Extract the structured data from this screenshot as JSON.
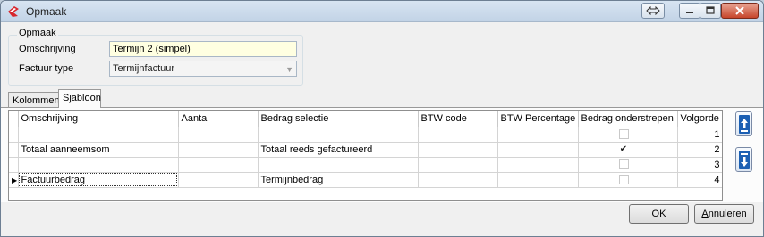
{
  "window": {
    "title": "Opmaak",
    "controls": [
      "restore-swap-icon",
      "minimize-icon",
      "maximize-icon",
      "close-icon"
    ]
  },
  "group": {
    "title": "Opmaak",
    "omschrijving_label": "Omschrijving",
    "omschrijving_value": "Termijn 2 (simpel)",
    "factuurtype_label": "Factuur type",
    "factuurtype_value": "Termijnfactuur"
  },
  "tabs": [
    {
      "label": "Kolommen",
      "active": false
    },
    {
      "label": "Sjabloon",
      "active": true
    }
  ],
  "grid": {
    "columns": [
      "Omschrijving",
      "Aantal",
      "Bedrag selectie",
      "BTW code",
      "BTW Percentage",
      "Bedrag onderstrepen",
      "Volgorde"
    ],
    "rows": [
      {
        "omschrijving": "",
        "aantal": "",
        "bedrag_selectie": "",
        "btw_code": "",
        "btw_percentage": "",
        "onderstrepen": false,
        "volgorde": "1",
        "current": false
      },
      {
        "omschrijving": "Totaal aanneemsom",
        "aantal": "",
        "bedrag_selectie": "Totaal reeds gefactureerd",
        "btw_code": "",
        "btw_percentage": "",
        "onderstrepen": true,
        "volgorde": "2",
        "current": false
      },
      {
        "omschrijving": "",
        "aantal": "",
        "bedrag_selectie": "",
        "btw_code": "",
        "btw_percentage": "",
        "onderstrepen": false,
        "volgorde": "3",
        "current": false
      },
      {
        "omschrijving": "Factuurbedrag",
        "aantal": "",
        "bedrag_selectie": "Termijnbedrag",
        "btw_code": "",
        "btw_percentage": "",
        "onderstrepen": false,
        "volgorde": "4",
        "current": true
      }
    ],
    "row_indicator": "▶",
    "check_mark": "✔"
  },
  "side_buttons": {
    "up_icon": "arrow-up-icon",
    "down_icon": "arrow-down-icon"
  },
  "buttons": {
    "ok_label": "OK",
    "cancel_prefix": "A",
    "cancel_rest": "nnuleren"
  },
  "colors": {
    "accent_field": "#ffffe1",
    "title_gradient": "#c2d3e6",
    "arrow_blue": "#1b5fb3"
  }
}
